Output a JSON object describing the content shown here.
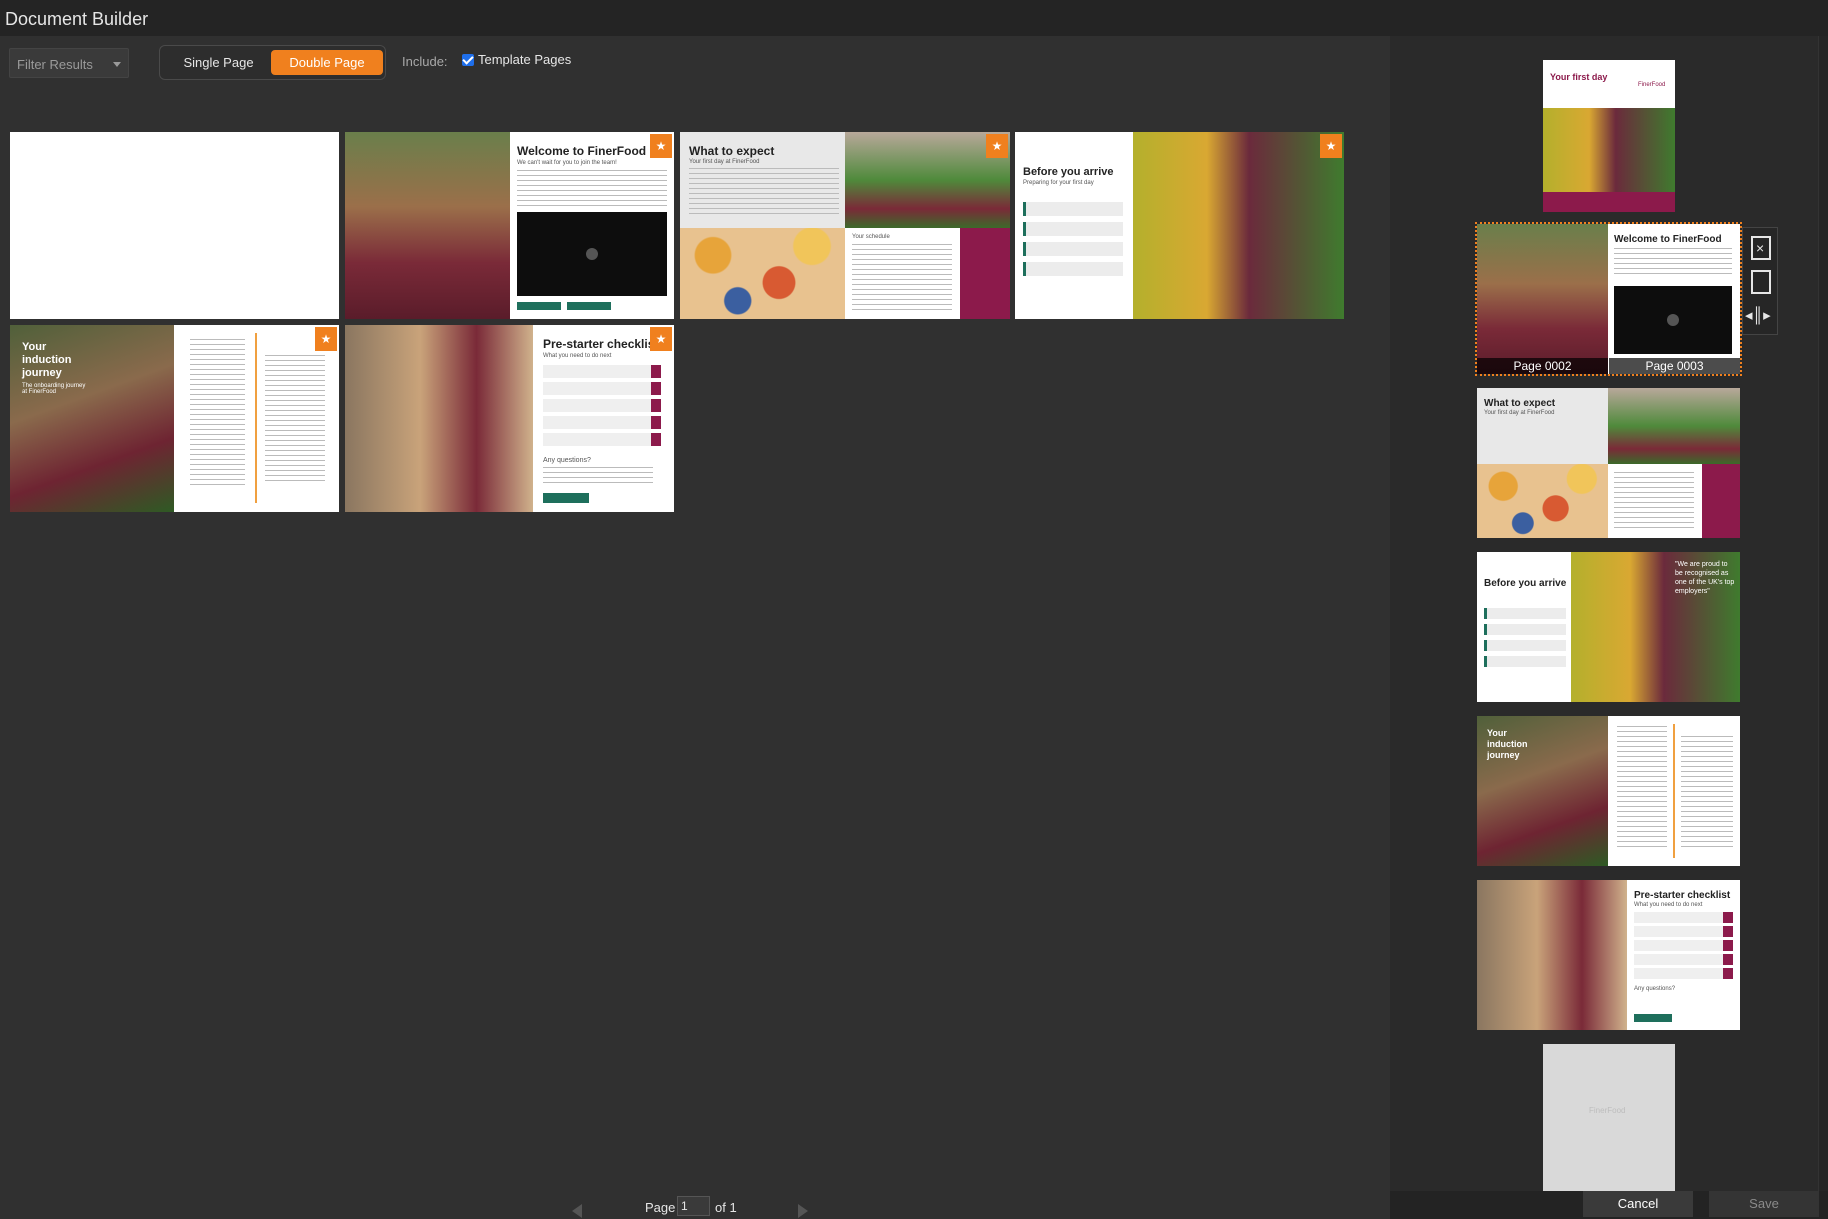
{
  "app": {
    "title": "Document Builder"
  },
  "toolbar": {
    "filter_placeholder": "Filter Results",
    "view_single": "Single Page",
    "view_double": "Double Page",
    "include_label": "Include:",
    "template_pages_label": "Template Pages",
    "template_pages_checked": true
  },
  "grid": {
    "pages": [
      {
        "title": ""
      },
      {
        "title": "Welcome to FinerFood",
        "subtitle": "We can't wait for you to join the team!"
      },
      {
        "title": "What to expect",
        "subtitle": "Your first day at FinerFood",
        "schedule_heading": "Your schedule"
      },
      {
        "title": "Before you arrive",
        "subtitle": "Preparing for your first day"
      },
      {
        "title": "Your induction journey",
        "subtitle": "The onboarding journey at FinerFood"
      },
      {
        "title": "Pre-starter checklis",
        "subtitle": "What you need to do next",
        "questions": "Any questions?"
      }
    ],
    "template_badge": "★"
  },
  "pager": {
    "prefix": "Page",
    "current": "1",
    "suffix": "of 1"
  },
  "side": {
    "thumbs": [
      {
        "title": "Your first day",
        "brand": "FinerFood"
      },
      {
        "title": "Welcome to FinerFood",
        "left_label": "Page 0002",
        "right_label": "Page 0003"
      },
      {
        "title": "What to expect",
        "subtitle": "Your first day at FinerFood"
      },
      {
        "title": "Before you arrive",
        "quote": "\"We are proud to be recognised as one of the UK's top employers\""
      },
      {
        "title": "Your induction journey"
      },
      {
        "title": "Pre-starter checklist",
        "subtitle": "What you need to do next",
        "questions": "Any questions?"
      },
      {
        "brand": "FinerFood"
      }
    ]
  },
  "footer": {
    "cancel": "Cancel",
    "save": "Save"
  }
}
